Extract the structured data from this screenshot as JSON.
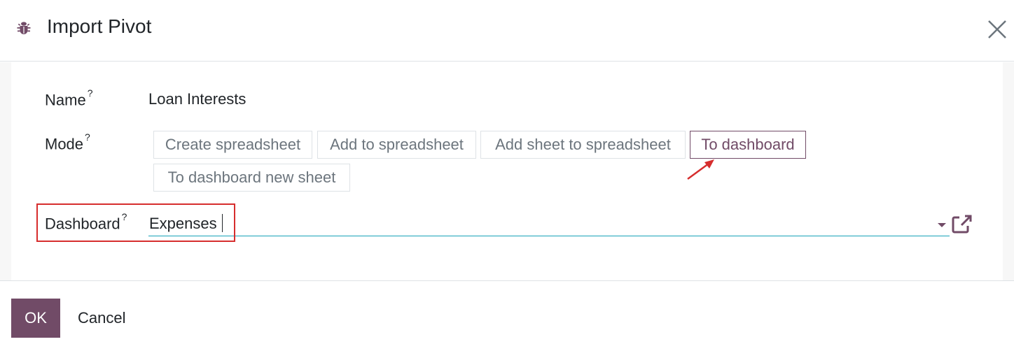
{
  "dialog": {
    "title": "Import Pivot",
    "close_icon": "close-icon",
    "title_icon": "bug-icon"
  },
  "form": {
    "name": {
      "label": "Name",
      "help": "?",
      "value": "Loan Interests"
    },
    "mode": {
      "label": "Mode",
      "help": "?",
      "options": [
        "Create spreadsheet",
        "Add to spreadsheet",
        "Add sheet to spreadsheet",
        "To dashboard",
        "To dashboard new sheet"
      ],
      "selected": "To dashboard"
    },
    "dashboard": {
      "label": "Dashboard",
      "help": "?",
      "value": "Expenses",
      "open_icon": "external-link-icon"
    }
  },
  "footer": {
    "ok_label": "OK",
    "cancel_label": "Cancel"
  },
  "colors": {
    "brand": "#714b67",
    "annotation": "#d62d2d",
    "input_underline": "#17a2b8"
  }
}
